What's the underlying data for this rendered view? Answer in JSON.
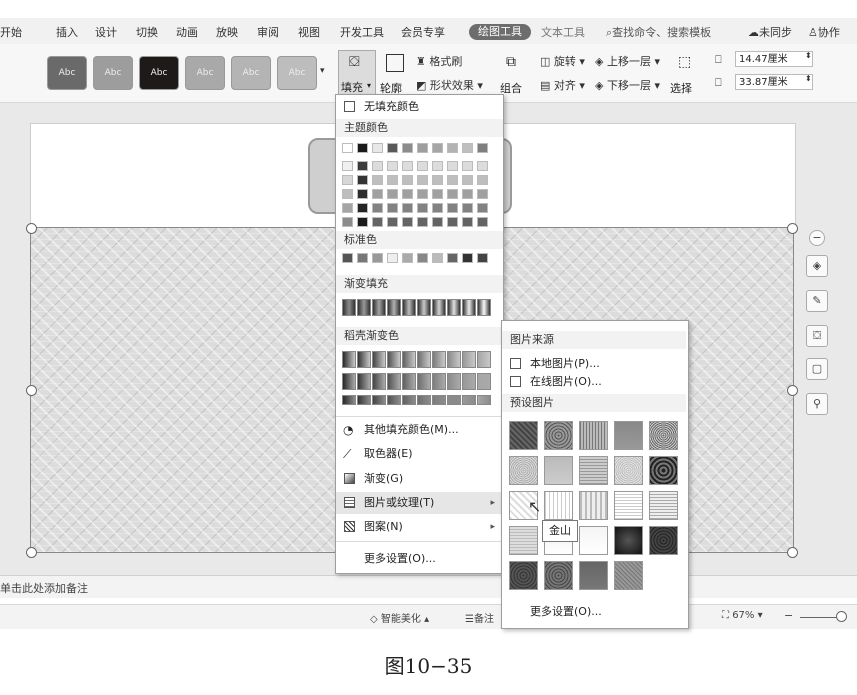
{
  "menubar": {
    "items": [
      "开始",
      "插入",
      "设计",
      "切换",
      "动画",
      "放映",
      "审阅",
      "视图",
      "开发工具",
      "会员专享"
    ],
    "active_tab": "绘图工具",
    "text_tool_tab": "文本工具",
    "search": "查找命令、搜索模板",
    "sync": "未同步",
    "collab": "协作"
  },
  "ribbon": {
    "style_buttons": [
      "Abc",
      "Abc",
      "Abc",
      "Abc",
      "Abc",
      "Abc"
    ],
    "fill_label": "填充",
    "outline_label": "轮廓",
    "format_brush": "格式刷",
    "shape_effect": "形状效果",
    "group_label": "组合",
    "rotate_label": "旋转",
    "align_label": "对齐",
    "bring_forward": "上移一层",
    "send_backward": "下移一层",
    "select_label": "选择",
    "width_value": "14.47厘米",
    "height_value": "33.87厘米"
  },
  "fill_menu": {
    "no_fill": "无填充颜色",
    "theme_colors": "主题颜色",
    "standard_colors": "标准色",
    "gradient_fill": "渐变填充",
    "shell_gradient": "稻壳渐变色",
    "more_fill": "其他填充颜色(M)...",
    "eyedropper": "取色器(E)",
    "gradient": "渐变(G)",
    "picture_texture": "图片或纹理(T)",
    "pattern": "图案(N)",
    "more_settings": "更多设置(O)..."
  },
  "sub_menu": {
    "source_header": "图片来源",
    "local_picture": "本地图片(P)...",
    "online_picture": "在线图片(O)...",
    "preset_header": "预设图片",
    "more_settings": "更多设置(O)..."
  },
  "tooltip": "金山",
  "notes": "单击此处添加备注",
  "status": {
    "smart_beautify": "智能美化",
    "notes_btn": "备注",
    "zoom": "67%"
  },
  "caption": "图10−35"
}
